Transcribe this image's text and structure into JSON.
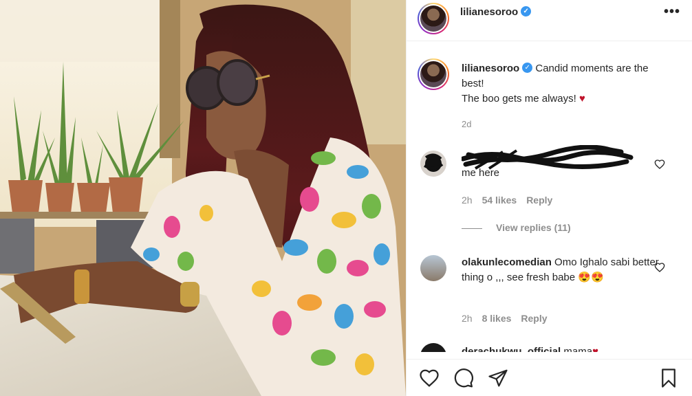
{
  "post": {
    "username": "lilianesoroo",
    "verified": true
  },
  "header": {
    "username": "lilianesoroo",
    "more_icon": "more-horizontal-icon",
    "more_label": "•••"
  },
  "caption": {
    "username": "lilianesoroo",
    "line1": "Candid moments are the best!",
    "line2": "The boo gets me always!",
    "emoji": "♥",
    "time": "2d"
  },
  "comments": [
    {
      "username_redacted": true,
      "text": "me here",
      "time": "2h",
      "likes": "54 likes",
      "reply": "Reply",
      "view_replies": "View replies (11)"
    },
    {
      "username": "olakunlecomedian",
      "text": "Omo Ighalo sabi better thing o ,,, see fresh babe",
      "emoji": "😍😍",
      "time": "2h",
      "likes": "8 likes",
      "reply": "Reply"
    },
    {
      "username": "derachukwu_official",
      "text": "mama",
      "emoji": "♥"
    }
  ],
  "actions": {
    "like_icon": "heart-outline-icon",
    "comment_icon": "comment-icon",
    "share_icon": "paper-plane-icon",
    "save_icon": "bookmark-icon"
  },
  "colors": {
    "accent": "#3897f0",
    "heart": "#c0142c",
    "muted": "#8e8e8e"
  }
}
